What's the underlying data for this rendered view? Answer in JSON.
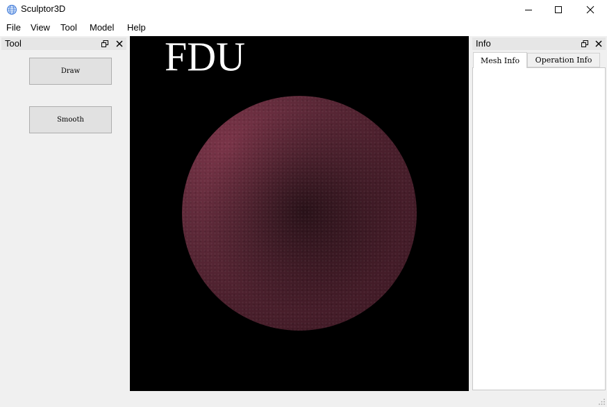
{
  "window": {
    "title": "Sculptor3D",
    "icons": {
      "app": "globe-icon",
      "minimize": "minimize-icon",
      "maximize": "maximize-icon",
      "close": "close-icon"
    }
  },
  "menu": {
    "items": [
      "File",
      "View",
      "Tool",
      "Model",
      "Help"
    ]
  },
  "tool_dock": {
    "title": "Tool",
    "buttons": {
      "draw": "Draw",
      "smooth": "Smooth"
    },
    "icons": {
      "float": "float-icon",
      "close": "close-icon"
    }
  },
  "viewport": {
    "overlay_text": "FDU",
    "background": "#000000",
    "sphere_color": "#602a3a"
  },
  "info_dock": {
    "title": "Info",
    "tabs": [
      "Mesh Info",
      "Operation Info"
    ],
    "active_tab": "Mesh Info",
    "icons": {
      "float": "float-icon",
      "close": "close-icon"
    }
  }
}
